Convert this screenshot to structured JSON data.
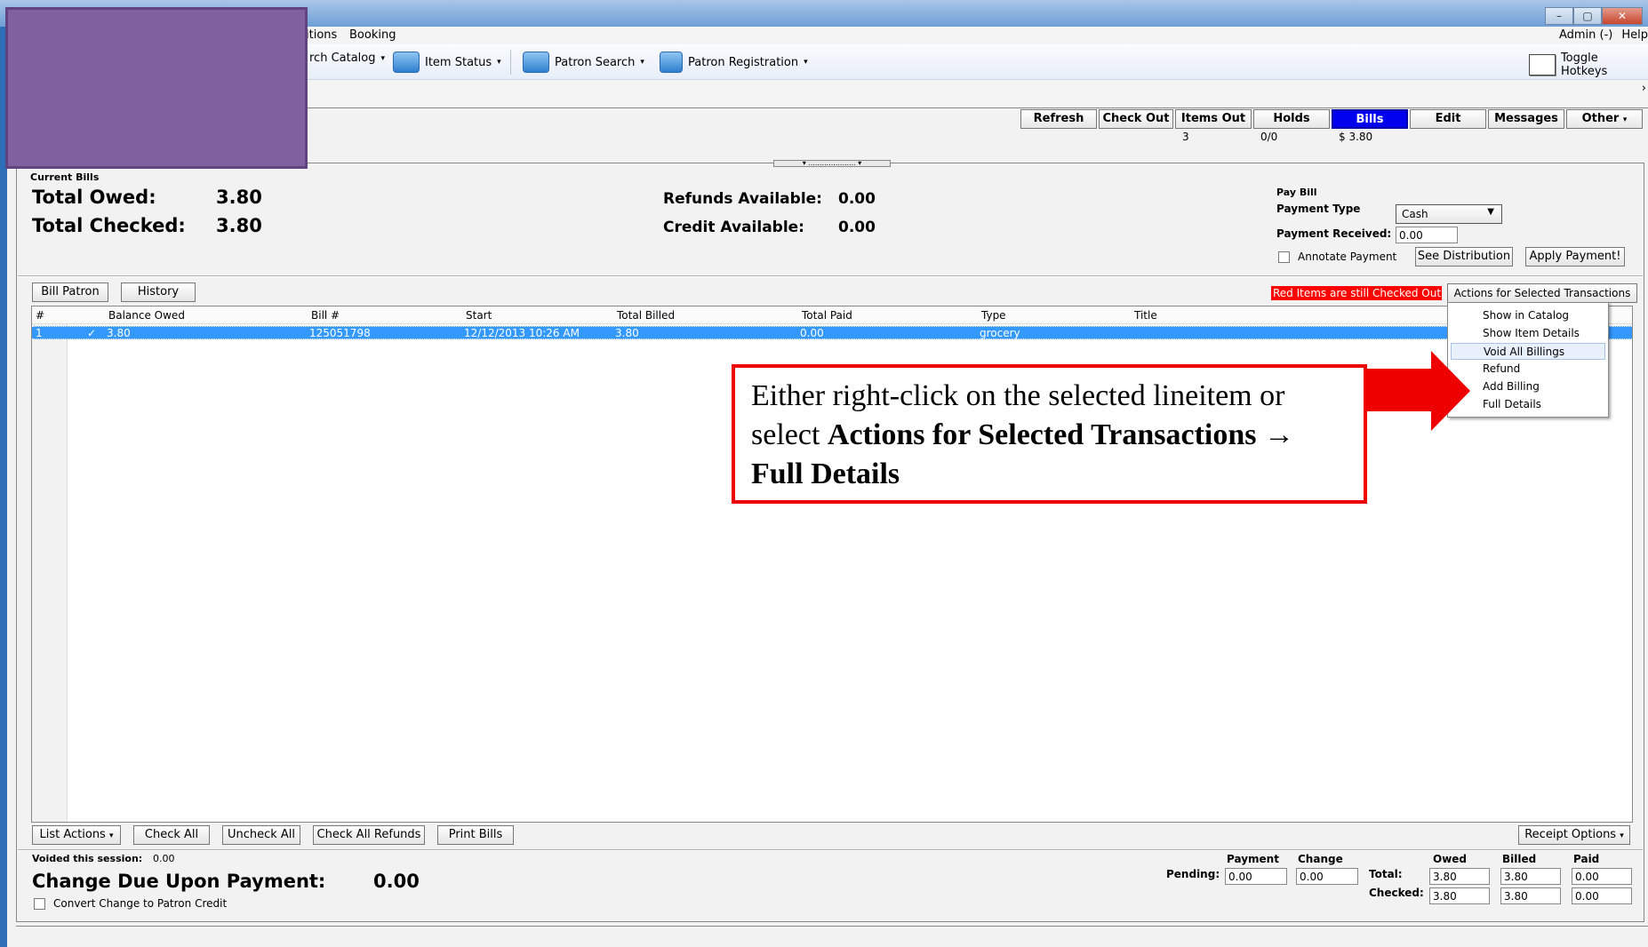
{
  "menubar": {
    "items": [
      "itions",
      "Booking"
    ],
    "admin": "Admin (-)",
    "help": "Help"
  },
  "toolbar": {
    "catalog": "rch Catalog",
    "item_status": "Item Status",
    "patron_search": "Patron Search",
    "patron_registration": "Patron Registration",
    "toggle_hotkeys": "Toggle Hotkeys"
  },
  "nav": {
    "buttons": [
      "Refresh",
      "Check Out",
      "Items Out",
      "Holds",
      "Bills",
      "Edit",
      "Messages",
      "Other"
    ],
    "counts": {
      "items_out": "3",
      "holds": "0/0",
      "bills": "$ 3.80"
    }
  },
  "bills": {
    "section_title": "Current Bills",
    "total_owed_label": "Total Owed:",
    "total_owed": "3.80",
    "total_checked_label": "Total Checked:",
    "total_checked": "3.80",
    "refunds_label": "Refunds Available:",
    "refunds": "0.00",
    "credit_label": "Credit Available:",
    "credit": "0.00"
  },
  "paybill": {
    "title": "Pay Bill",
    "payment_type_label": "Payment Type",
    "payment_type": "Cash",
    "payment_received_label": "Payment Received:",
    "payment_received": "0.00",
    "annotate": "Annotate Payment",
    "see_distribution": "See Distribution",
    "apply_payment": "Apply Payment!"
  },
  "actions": {
    "bill_patron": "Bill Patron",
    "history": "History",
    "red_warning": "Red Items are still Checked Out",
    "actions_for_selected": "Actions for Selected Transactions"
  },
  "table": {
    "headers": [
      "#",
      "Balance Owed",
      "Bill #",
      "Start",
      "Total Billed",
      "Total Paid",
      "Type",
      "Title"
    ],
    "row": {
      "num": "1",
      "check": "✓",
      "balance": "3.80",
      "bill": "125051798",
      "start": "12/12/2013 10:26 AM",
      "billed": "3.80",
      "paid": "0.00",
      "type": "grocery"
    }
  },
  "menu": [
    "Show in Catalog",
    "Show Item Details",
    "Void All Billings",
    "Refund",
    "Add Billing",
    "Full Details"
  ],
  "callout": {
    "line1": "Either right-click on the selected lineitem or",
    "line2_pre": "select ",
    "line2_bold": "Actions for Selected Transactions →",
    "line3_bold": "Full Details"
  },
  "bottom": {
    "list_actions": "List Actions",
    "check_all": "Check All",
    "uncheck_all": "Uncheck All",
    "check_all_refunds": "Check All Refunds",
    "print_bills": "Print Bills",
    "receipt_options": "Receipt Options",
    "voided_label": "Voided this session:",
    "voided": "0.00",
    "change_due": "Change Due Upon Payment:",
    "change_due_value": "0.00",
    "convert_change": "Convert Change to Patron Credit"
  },
  "totals": {
    "payment_h": "Payment",
    "change_h": "Change",
    "owed_h": "Owed",
    "billed_h": "Billed",
    "paid_h": "Paid",
    "pending_label": "Pending:",
    "pending_payment": "0.00",
    "pending_change": "0.00",
    "total_label": "Total:",
    "total_owed": "3.80",
    "total_billed": "3.80",
    "total_paid": "0.00",
    "checked_label": "Checked:",
    "checked_owed": "3.80",
    "checked_billed": "3.80",
    "checked_paid": "0.00"
  },
  "colors": {
    "accent": "#0000ee",
    "callout_border": "#e00000",
    "selection": "#3399ff",
    "redacted": "#80609e"
  }
}
